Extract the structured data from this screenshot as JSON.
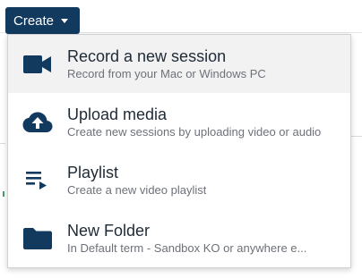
{
  "create_button": {
    "label": "Create",
    "bg_color": "#123a5f"
  },
  "menu": {
    "items": [
      {
        "label": "Record a new session",
        "description": "Record from your Mac or Windows PC",
        "icon": "video-camera-icon",
        "active": true
      },
      {
        "label": "Upload media",
        "description": "Create new sessions by uploading video or audio",
        "icon": "cloud-upload-icon",
        "active": false
      },
      {
        "label": "Playlist",
        "description": "Create a new video playlist",
        "icon": "playlist-icon",
        "active": false
      },
      {
        "label": "New Folder",
        "description": "In Default term - Sandbox KO or anywhere e...",
        "icon": "folder-icon",
        "active": false
      }
    ]
  },
  "colors": {
    "icon": "#123a5f",
    "hover_bg": "#f2f2f2",
    "label_text": "#1f2a37",
    "desc_text": "#6d7178"
  }
}
